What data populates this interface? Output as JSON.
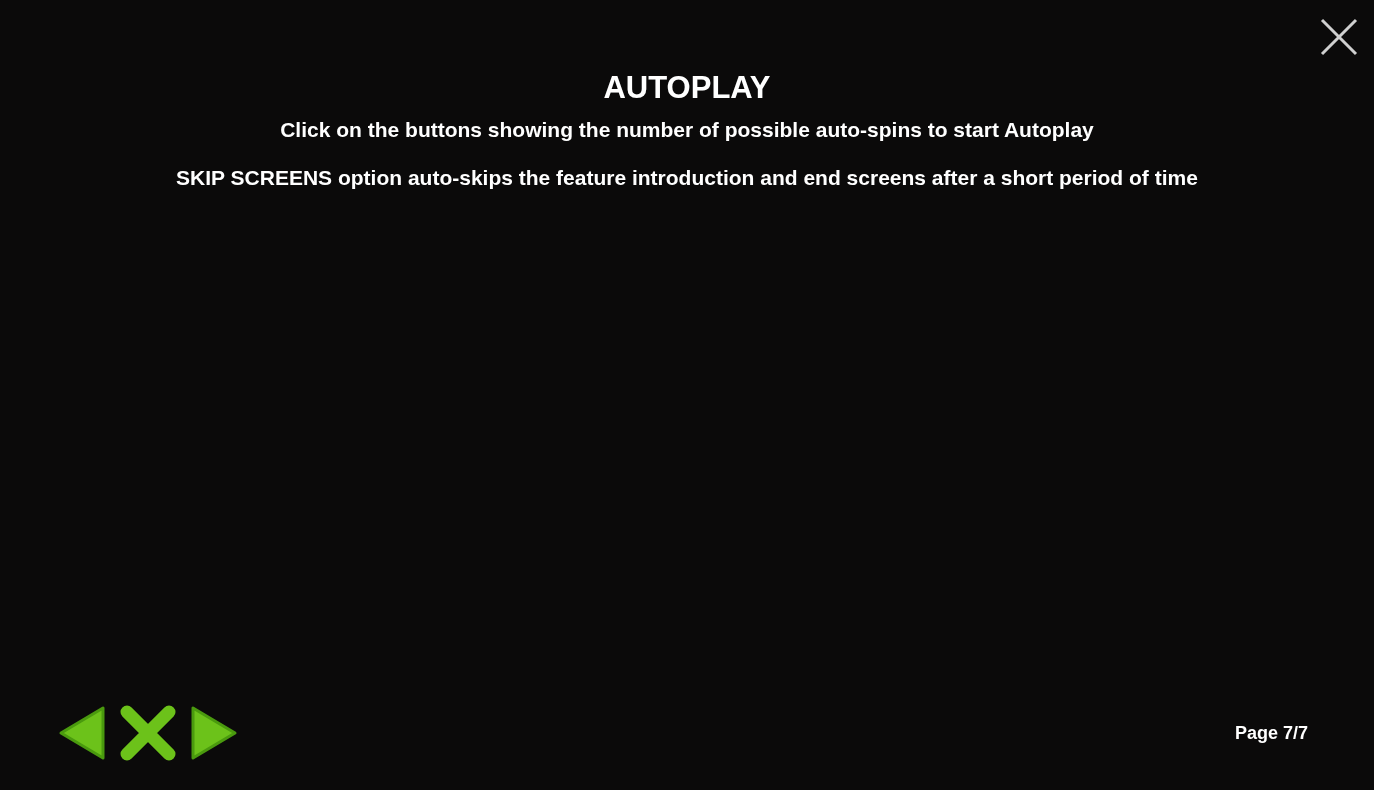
{
  "title": "AUTOPLAY",
  "paragraphs": [
    "Click on the buttons showing the number of possible auto-spins to start Autoplay",
    "SKIP SCREENS option auto-skips the feature introduction and end screens after a short period of time"
  ],
  "page_indicator": "Page 7/7"
}
